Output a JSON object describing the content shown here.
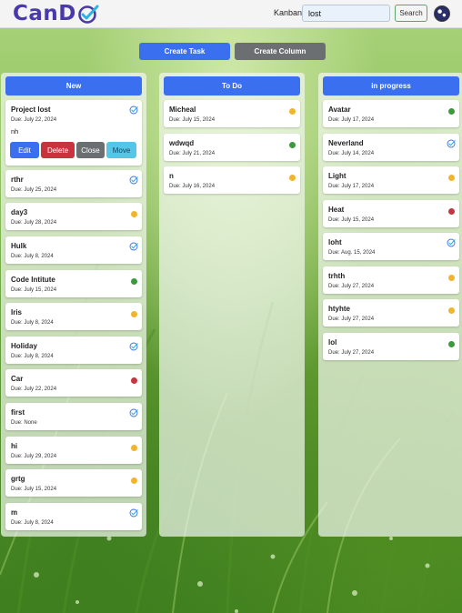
{
  "brand": {
    "name": "CanD"
  },
  "nav": {
    "board_label": "Kanban",
    "search_value": "lost",
    "search_button": "Search"
  },
  "toolbar": {
    "create_task": "Create Task",
    "create_column": "Create Column"
  },
  "colors": {
    "primary": "#3a6ff0",
    "secondary": "#6c6f72",
    "danger": "#c8343e",
    "move": "#55c5e8",
    "yellow": "#f1b52b",
    "green": "#3c9a3d",
    "red": "#c8343e",
    "check": "#3a6ff0"
  },
  "columns": [
    {
      "title": "New",
      "cards": [
        {
          "title": "Project lost",
          "due": "Due: July 22, 2024",
          "desc": "nh",
          "status": "check",
          "actions": {
            "edit": "Edit",
            "delete": "Delete",
            "close": "Close",
            "move": "Move"
          }
        },
        {
          "title": "rthr",
          "due": "Due: July 25, 2024",
          "status": "check"
        },
        {
          "title": "day3",
          "due": "Due: July 28, 2024",
          "status": "yellow"
        },
        {
          "title": "Hulk",
          "due": "Due: July 8, 2024",
          "status": "check"
        },
        {
          "title": "Code Intitute",
          "due": "Due: July 15, 2024",
          "status": "green"
        },
        {
          "title": "Iris",
          "due": "Due: July 8, 2024",
          "status": "yellow"
        },
        {
          "title": "Holiday",
          "due": "Due: July 8, 2024",
          "status": "check"
        },
        {
          "title": "Car",
          "due": "Due: July 22, 2024",
          "status": "red"
        },
        {
          "title": "first",
          "due": "Due: None",
          "status": "check"
        },
        {
          "title": "hi",
          "due": "Due: July 29, 2024",
          "status": "yellow"
        },
        {
          "title": "grtg",
          "due": "Due: July 15, 2024",
          "status": "yellow"
        },
        {
          "title": "m",
          "due": "Due: July 8, 2024",
          "status": "check"
        }
      ]
    },
    {
      "title": "To Do",
      "cards": [
        {
          "title": "Micheal",
          "due": "Due: July 15, 2024",
          "status": "yellow"
        },
        {
          "title": "wdwqd",
          "due": "Due: July 21, 2024",
          "status": "green"
        },
        {
          "title": "n",
          "due": "Due: July 16, 2024",
          "status": "yellow"
        }
      ]
    },
    {
      "title": "in progress",
      "cards": [
        {
          "title": "Avatar",
          "due": "Due: July 17, 2024",
          "status": "green"
        },
        {
          "title": "Neverland",
          "due": "Due: July 14, 2024",
          "status": "check"
        },
        {
          "title": "Light",
          "due": "Due: July 17, 2024",
          "status": "yellow"
        },
        {
          "title": "Heat",
          "due": "Due: July 15, 2024",
          "status": "red"
        },
        {
          "title": "loht",
          "due": "Due: Aug. 15, 2024",
          "status": "check"
        },
        {
          "title": "trhth",
          "due": "Due: July 27, 2024",
          "status": "yellow"
        },
        {
          "title": "htyhte",
          "due": "Due: July 27, 2024",
          "status": "yellow"
        },
        {
          "title": "lol",
          "due": "Due: July 27, 2024",
          "status": "green"
        }
      ]
    }
  ]
}
